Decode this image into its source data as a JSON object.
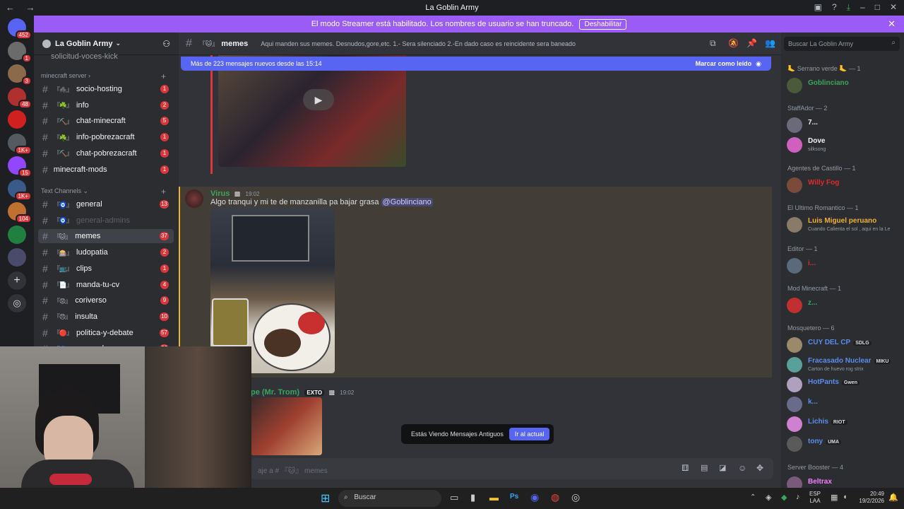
{
  "window": {
    "title": "La Goblin Army"
  },
  "banner": {
    "text": "El modo Streamer está habilitado. Los nombres de usuario se han truncado.",
    "button": "Deshabilitar"
  },
  "guilds": [
    {
      "badge": "452",
      "color": "#5865f2"
    },
    {
      "badge": "1",
      "color": "#6b6b6b"
    },
    {
      "badge": "3",
      "color": "#8a6a4a"
    },
    {
      "badge": "48",
      "color": "#b03030"
    },
    {
      "badge": "",
      "color": "#d02020"
    },
    {
      "badge": "1K+",
      "color": "#555a60"
    },
    {
      "badge": "15",
      "color": "#9146ff"
    },
    {
      "badge": "1K+",
      "color": "#3a5a8a"
    },
    {
      "badge": "104",
      "color": "#c07030"
    },
    {
      "badge": "",
      "color": "#208040"
    },
    {
      "badge": "",
      "color": "#4a4a6a"
    }
  ],
  "server": {
    "name": "La Goblin Army"
  },
  "channels": {
    "partial_top": "solicitud-voces-kick",
    "cat_minecraft": "minecraft server",
    "cat_text": "Text Channels",
    "items": [
      {
        "emoji": "『🕷️』",
        "name": "socio-hosting",
        "count": "1"
      },
      {
        "emoji": "『☘️』",
        "name": "info",
        "count": "2"
      },
      {
        "emoji": "『⛏️』",
        "name": "chat-minecraft",
        "count": "5"
      },
      {
        "emoji": "『☘️』",
        "name": "info-pobrezacraft",
        "count": "1"
      },
      {
        "emoji": "『⛏️』",
        "name": "chat-pobrezacraft",
        "count": "1"
      },
      {
        "emoji": "",
        "name": "minecraft-mods",
        "count": "1"
      },
      {
        "emoji": "『🧿』",
        "name": "general",
        "count": "13"
      },
      {
        "emoji": "『🧿』",
        "name": "general-admins",
        "count": ""
      },
      {
        "emoji": "『🐱』",
        "name": "memes",
        "count": "37"
      },
      {
        "emoji": "『🎰』",
        "name": "ludopatia",
        "count": "2"
      },
      {
        "emoji": "『📺』",
        "name": "clips",
        "count": "1"
      },
      {
        "emoji": "『📄』",
        "name": "manda-tu-cv",
        "count": "4"
      },
      {
        "emoji": "『😡』",
        "name": "coriverso",
        "count": "9"
      },
      {
        "emoji": "『😠』",
        "name": "insulta",
        "count": "10"
      },
      {
        "emoji": "『🔴』",
        "name": "politica-y-debate",
        "count": "57"
      },
      {
        "emoji": "『🧿』",
        "name": "comandos",
        "count": "26"
      }
    ]
  },
  "channel_header": {
    "emoji": "『🐱』",
    "name": "memes",
    "topic": "Aqui manden sus memes. Desnudos,gore,etc. 1.- Sera silenciado 2.-En dado caso es reincidente sera baneado"
  },
  "search": {
    "placeholder": "Buscar La Goblin Army"
  },
  "new_messages": {
    "text": "Más de 223 mensajes nuevos desde las 15:14",
    "mark_read": "Marcar como leído"
  },
  "messages": [
    {
      "author": "Virus",
      "time": "19:02",
      "text": "Algo tranqui y mi te de manzanilla pa bajar grasa",
      "mention": "@Goblinciano"
    },
    {
      "author": "pe (Mr. Trom)",
      "tag": "EXTO",
      "time": "19:02"
    }
  ],
  "old_messages": {
    "text": "Estás Viendo Mensajes Antiguos",
    "button": "Ir al actual"
  },
  "composer": {
    "placeholder": "aje a # 『🐱』 memes"
  },
  "members": {
    "groups": [
      {
        "title": "🦶 Serrano verde 🦶 — 1",
        "members": [
          {
            "name": "Goblinciano",
            "color": "#3ba55c",
            "sub": "",
            "tag": ""
          }
        ]
      },
      {
        "title": "StaffAdor — 2",
        "members": [
          {
            "name": "7...",
            "color": "#f2f3f5",
            "sub": "",
            "tag": ""
          },
          {
            "name": "Dove",
            "color": "#f2f3f5",
            "sub": "silksong",
            "tag": ""
          }
        ]
      },
      {
        "title": "Agentes de Castillo — 1",
        "members": [
          {
            "name": "Willy Fog",
            "color": "#e02b2b",
            "sub": "",
            "tag": ""
          }
        ]
      },
      {
        "title": "El Ultimo Romantico — 1",
        "members": [
          {
            "name": "Luis Miguel peruano",
            "color": "#f0b232",
            "sub": "Cuando Calienta el sol , aqui en la Le",
            "tag": ""
          }
        ]
      },
      {
        "title": "Editor — 1",
        "members": [
          {
            "name": "i...",
            "color": "#e02b2b",
            "sub": "",
            "tag": ""
          }
        ]
      },
      {
        "title": "Mod Minecraft — 1",
        "members": [
          {
            "name": "z...",
            "color": "#3ba55c",
            "sub": "",
            "tag": ""
          }
        ]
      },
      {
        "title": "Mosquetero — 6",
        "members": [
          {
            "name": "CUY DEL CP",
            "color": "#5b8def",
            "sub": "",
            "tag": "SDLG"
          },
          {
            "name": "Fracasado Nuclear",
            "color": "#5b8def",
            "sub": "Carton de huevo rog strix",
            "tag": "MIKU"
          },
          {
            "name": "HotPants",
            "color": "#5b8def",
            "sub": "",
            "tag": "Gwen"
          },
          {
            "name": "k...",
            "color": "#5b8def",
            "sub": "",
            "tag": ""
          },
          {
            "name": "Lichis",
            "color": "#5b8def",
            "sub": "",
            "tag": "RIOT"
          },
          {
            "name": "tony",
            "color": "#5b8def",
            "sub": "",
            "tag": "UMA"
          }
        ]
      },
      {
        "title": "Server Booster — 4",
        "members": [
          {
            "name": "Beltrax",
            "color": "#f47fff",
            "sub": "",
            "tag": ""
          }
        ]
      }
    ]
  },
  "taskbar": {
    "search": "Buscar",
    "lang": "ESP",
    "lang2": "LAA",
    "time": "20:49",
    "date": "19/2/2026"
  }
}
